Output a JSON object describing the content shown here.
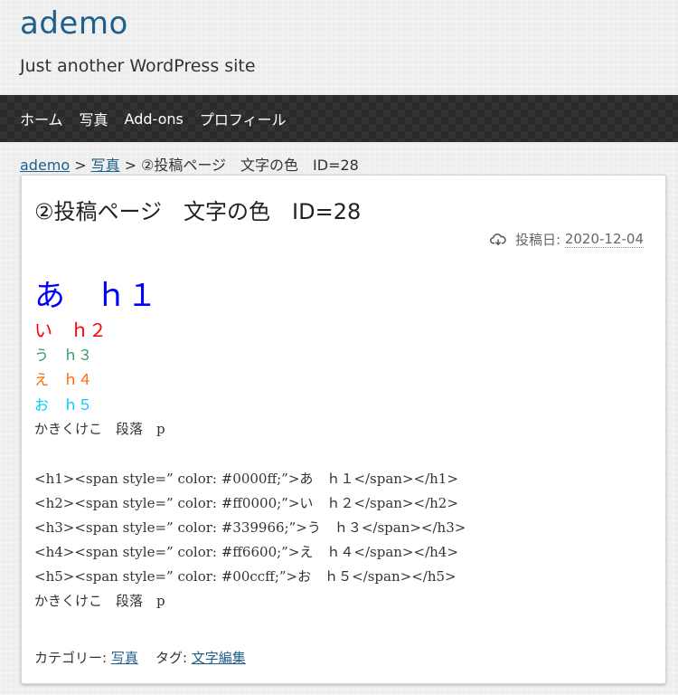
{
  "site": {
    "title": "ademo",
    "description": "Just another WordPress site"
  },
  "nav": {
    "items": [
      "ホーム",
      "写真",
      "Add-ons",
      "プロフィール"
    ]
  },
  "breadcrumb": {
    "home": "ademo",
    "sep": ">",
    "category": "写真",
    "current": "②投稿ページ　文字の色　ID=28"
  },
  "post": {
    "title": "②投稿ページ　文字の色　ID=28",
    "date_label": "投稿日:",
    "date": "2020-12-04",
    "headings": {
      "h1": "あ　ｈ１",
      "h2": "い　ｈ２",
      "h3": "う　ｈ３",
      "h4": "え　ｈ４",
      "h5": "お　ｈ５"
    },
    "paragraph": "かきくけこ　段落　p",
    "code_lines": [
      "<h1><span style=” color: #0000ff;”>あ　ｈ１</span></h1>",
      "<h2><span style=” color: #ff0000;”>い　ｈ２</span></h2>",
      "<h3><span style=” color: #339966;”>う　ｈ３</span></h3>",
      "<h4><span style=” color: #ff6600;”>え　ｈ４</span></h4>",
      "<h5><span style=” color: #00ccff;”>お　ｈ５</span></h5>"
    ],
    "paragraph2": "かきくけこ　段落　p",
    "category_label": "カテゴリー:",
    "category": "写真",
    "tag_label": "タグ:",
    "tag": "文字編集"
  },
  "colors": {
    "link": "#1f5f8b",
    "h1": "#0000ff",
    "h2": "#ff0000",
    "h3": "#339966",
    "h4": "#ff6600",
    "h5": "#00ccff"
  },
  "icons": {
    "date": "cloud-icon"
  }
}
